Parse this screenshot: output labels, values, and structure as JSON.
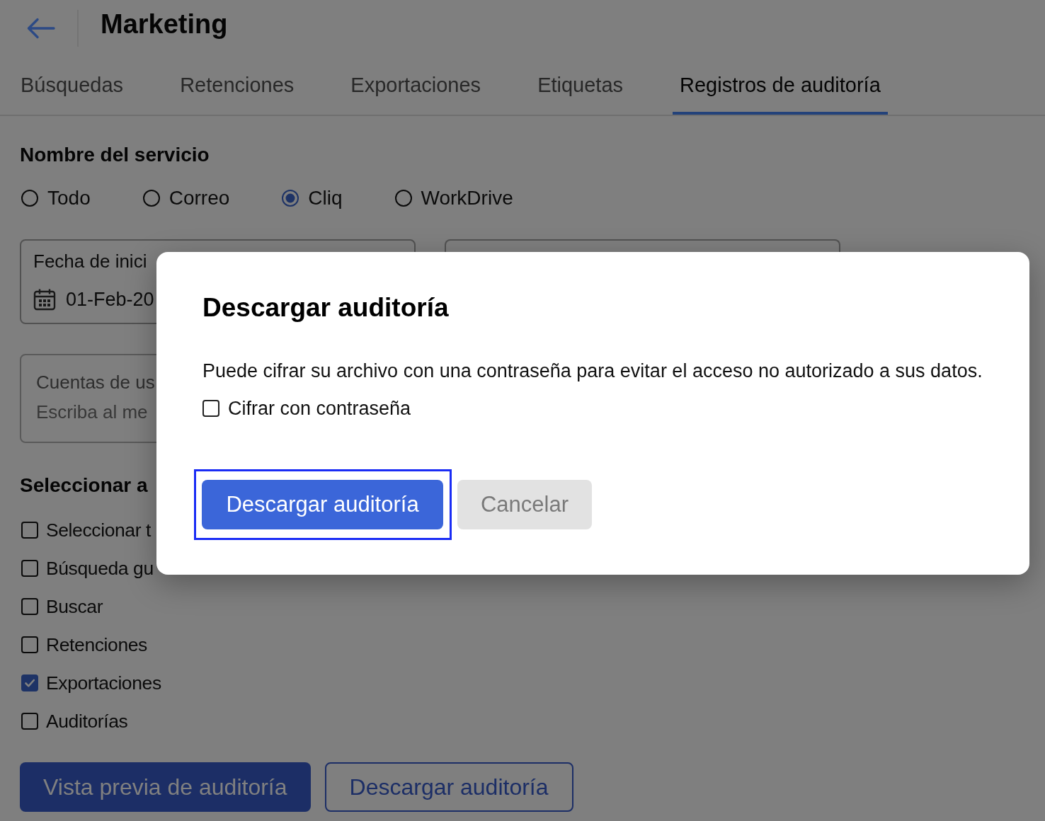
{
  "header": {
    "title": "Marketing"
  },
  "tabs": [
    {
      "label": "Búsquedas",
      "selected": false
    },
    {
      "label": "Retenciones",
      "selected": false
    },
    {
      "label": "Exportaciones",
      "selected": false
    },
    {
      "label": "Etiquetas",
      "selected": false
    },
    {
      "label": "Registros de auditoría",
      "selected": true
    }
  ],
  "service": {
    "heading": "Nombre del servicio",
    "options": [
      {
        "label": "Todo",
        "selected": false
      },
      {
        "label": "Correo",
        "selected": false
      },
      {
        "label": "Cliq",
        "selected": true
      },
      {
        "label": "WorkDrive",
        "selected": false
      }
    ]
  },
  "start_date": {
    "label": "Fecha de inici",
    "value": "01-Feb-20"
  },
  "accounts": {
    "label": "Cuentas de us",
    "placeholder": "Escriba al me"
  },
  "actions": {
    "heading": "Seleccionar a",
    "options": [
      {
        "label": "Seleccionar t",
        "checked": false
      },
      {
        "label": "Búsqueda gu",
        "checked": false
      },
      {
        "label": "Buscar",
        "checked": false
      },
      {
        "label": "Retenciones",
        "checked": false
      },
      {
        "label": "Exportaciones",
        "checked": true
      },
      {
        "label": "Auditorías",
        "checked": false
      }
    ]
  },
  "buttons": [
    {
      "label": "Vista previa de auditoría",
      "kind": "primary"
    },
    {
      "label": "Descargar auditoría",
      "kind": "outline"
    }
  ],
  "dialog": {
    "title": "Descargar auditoría",
    "message": "Puede cifrar su archivo con una contraseña para evitar el acceso no autorizado a sus datos.",
    "encrypt": {
      "label": "Cifrar con contraseña",
      "checked": false
    },
    "buttons": [
      {
        "label": "Descargar auditoría",
        "kind": "primary",
        "focused": true
      },
      {
        "label": "Cancelar",
        "kind": "secondary",
        "focused": false
      }
    ]
  }
}
